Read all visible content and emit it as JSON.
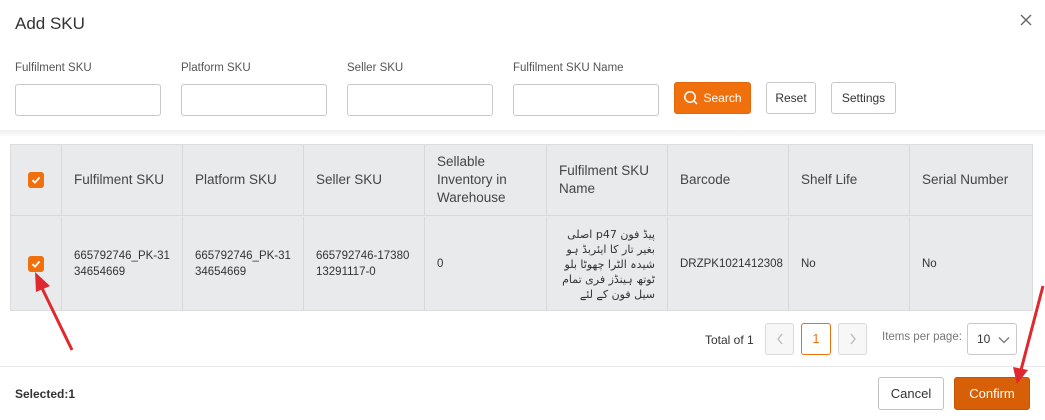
{
  "dialog": {
    "title": "Add SKU"
  },
  "filters": [
    {
      "label": "Fulfilment SKU",
      "value": "",
      "placeholder": ""
    },
    {
      "label": "Platform SKU",
      "value": "",
      "placeholder": ""
    },
    {
      "label": "Seller SKU",
      "value": "",
      "placeholder": ""
    },
    {
      "label": "Fulfilment SKU Name",
      "value": "",
      "placeholder": ""
    }
  ],
  "buttons": {
    "search": "Search",
    "reset": "Reset",
    "settings": "Settings",
    "cancel": "Cancel",
    "confirm": "Confirm"
  },
  "table": {
    "header_select_all_checked": true,
    "columns": [
      "Fulfilment SKU",
      "Platform SKU",
      "Seller SKU",
      "Sellable Inventory in Warehouse",
      "Fulfilment SKU Name",
      "Barcode",
      "Shelf Life",
      "Serial Number"
    ],
    "rows": [
      {
        "checked": true,
        "fulfilment_sku": "665792746_PK-3134654669",
        "platform_sku": "665792746_PK-3134654669",
        "seller_sku": "665792746-1738013291117-0",
        "sellable_inventory": "0",
        "fulfilment_sku_name": "پیڈ فون p47 اصلی بغیر تار کا ایئربڈ ہو شیدہ الٹرا چھوٹا بلو ٹوتھ ہینڈز فری تمام سیل فون کے لئے",
        "barcode": "DRZPK1021412308",
        "shelf_life": "No",
        "serial_number": "No"
      }
    ]
  },
  "pagination": {
    "total_label": "Total of 1",
    "current_page": "1",
    "items_per_page_label": "Items per page:",
    "items_per_page": "10"
  },
  "footer": {
    "selected_label": "Selected:1"
  },
  "colors": {
    "accent": "#f0700e",
    "confirm": "#d65f07",
    "annotation_arrow": "#e0292e"
  },
  "icons": {
    "close": "close-icon",
    "search": "search-icon",
    "check": "check-icon",
    "prev": "chevron-left-icon",
    "next": "chevron-right-icon",
    "dropdown": "chevron-down-icon"
  }
}
